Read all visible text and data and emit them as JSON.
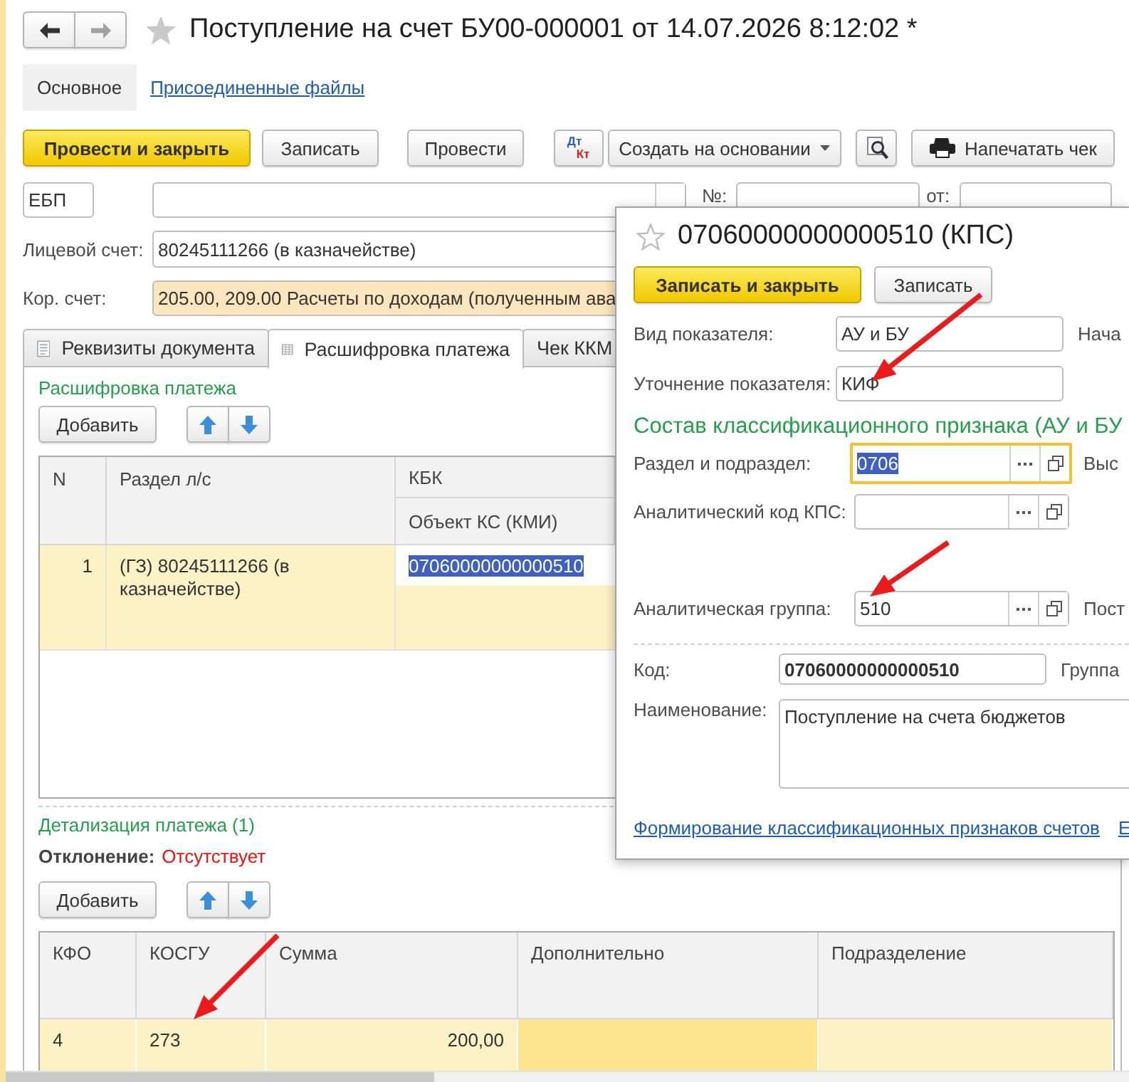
{
  "window": {
    "title": "Поступление на счет БУ00-000001 от 14.07.2026 8:12:02 *",
    "starred": false
  },
  "nav": [
    {
      "kind": "back",
      "disabled": false
    },
    {
      "kind": "forward",
      "disabled": true
    }
  ],
  "sections": [
    {
      "label": "Основное",
      "selected": true
    },
    {
      "label": "Присоединенные файлы",
      "selected": false
    }
  ],
  "toolbar": [
    {
      "kind": "primary",
      "label": "Провести и закрыть"
    },
    {
      "kind": "button",
      "label": "Записать"
    },
    {
      "kind": "button",
      "label": "Провести"
    },
    {
      "kind": "dt_kt",
      "debit": "Дт",
      "credit": "Кт"
    },
    {
      "kind": "dropdown",
      "label": "Создать на основании"
    },
    {
      "kind": "search"
    },
    {
      "kind": "print",
      "label": "Напечатать чек"
    }
  ],
  "header_fields": {
    "type_value": "ЕБП",
    "number_label": "№:",
    "date_label": "от:"
  },
  "account": {
    "label": "Лицевой счет:",
    "value": "80245111266 (в казначействе)"
  },
  "corr_account": {
    "label": "Кор. счет:",
    "value": "205.00, 209.00 Расчеты по доходам (полученным ава"
  },
  "tabs": [
    {
      "kind": "document",
      "label": "Реквизиты документа",
      "selected": false
    },
    {
      "kind": "table",
      "label": "Расшифровка платежа",
      "selected": true
    },
    {
      "kind": "plain",
      "label": "Чек ККМ",
      "selected": false
    }
  ],
  "breakdown": {
    "title": "Расшифровка платежа",
    "add_button": "Добавить",
    "columns": {
      "n": "N",
      "section": "Раздел л/с",
      "kbk": "КБК",
      "object": "Объект КС (КМИ)"
    },
    "rows": [
      {
        "n": "1",
        "section": "(ГЗ) 80245111266 (в казначействе)",
        "kbk": "07060000000000510",
        "selected": true,
        "kbk_editing": true
      }
    ]
  },
  "details": {
    "title": "Детализация платежа (1)",
    "deviation_label": "Отклонение:",
    "deviation_value": "Отсутствует",
    "add_button": "Добавить",
    "columns": [
      "КФО",
      "КОСГУ",
      "Сумма",
      "Дополнительно",
      "Подразделение"
    ],
    "rows": [
      {
        "selected": true,
        "cells": [
          {
            "text": "4",
            "focused": false
          },
          {
            "text": "273",
            "focused": false
          },
          {
            "text": "200,00",
            "focused": false
          },
          {
            "focused": true
          },
          {
            "focused": false
          }
        ]
      }
    ]
  },
  "dialog": {
    "title": "07060000000000510 (КПС)",
    "starred": false,
    "buttons": [
      {
        "kind": "primary",
        "label": "Записать и закрыть"
      },
      {
        "kind": "button",
        "label": "Записать"
      }
    ],
    "fields": [
      {
        "label": "Вид показателя:",
        "value": "АУ и БУ",
        "aside": "Нача"
      },
      {
        "label": "Уточнение показателя:",
        "value": "КИФ"
      }
    ],
    "group_title": "Состав классификационного признака (АУ и БУ",
    "group_fields": [
      {
        "label": "Раздел и подраздел:",
        "value": "0706",
        "focused": true,
        "aside": "Выс"
      },
      {
        "label": "Аналитический код КПС:",
        "focused": false
      },
      {
        "label": "Аналитическая группа:",
        "value": "510",
        "focused": false,
        "aside": "Пост"
      }
    ],
    "code": {
      "label": "Код:",
      "value": "07060000000000510",
      "aside": "Группа"
    },
    "name": {
      "label": "Наименование:",
      "value": "Поступление на счета бюджетов"
    },
    "links": [
      "Формирование классификационных признаков счетов",
      "Е"
    ]
  }
}
